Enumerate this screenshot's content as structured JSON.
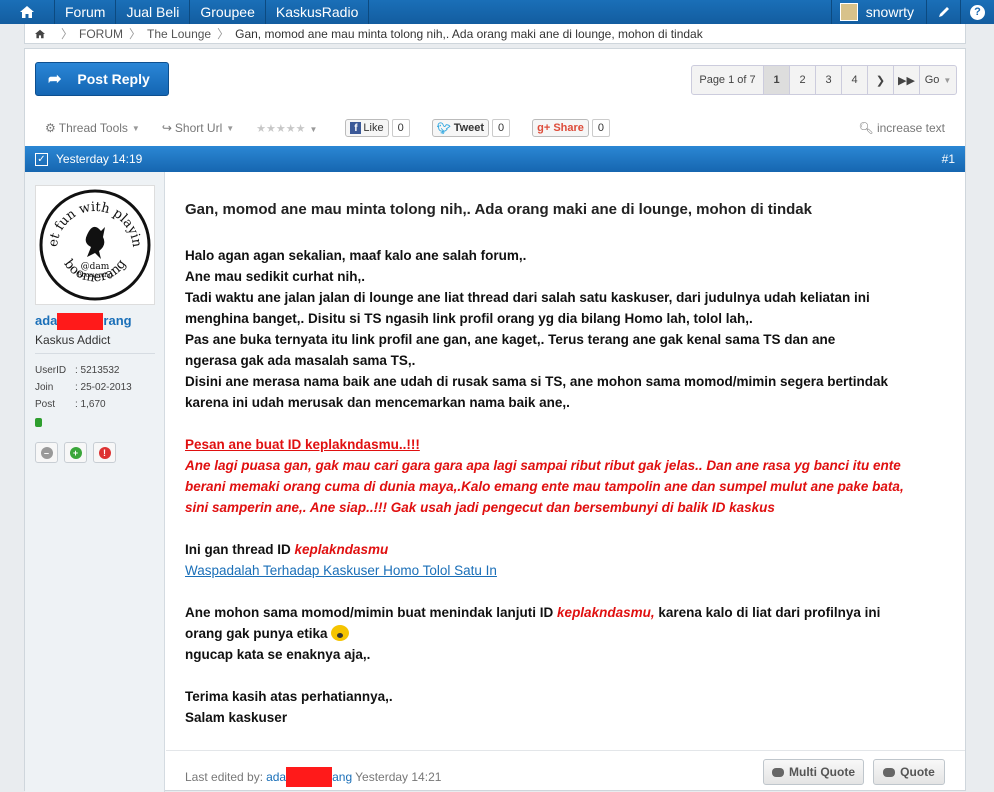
{
  "topnav": {
    "items": [
      "Forum",
      "Jual Beli",
      "Groupee",
      "KaskusRadio"
    ],
    "username": "snowrty"
  },
  "breadcrumb": {
    "forum": "FORUM",
    "section": "The Lounge",
    "current": "Gan, momod ane mau minta tolong nih,. Ada orang maki ane di lounge, mohon di tindak"
  },
  "actions": {
    "post_reply": "Post Reply"
  },
  "pagination": {
    "info": "Page 1 of 7",
    "pages": [
      "1",
      "2",
      "3",
      "4"
    ],
    "current": "1",
    "go": "Go"
  },
  "toolbar": {
    "thread_tools": "Thread Tools",
    "short_url": "Short Url",
    "like_label": "Like",
    "like_count": "0",
    "tweet_label": "Tweet",
    "tweet_count": "0",
    "share_label": "Share",
    "share_count": "0",
    "increase_text": "increase text"
  },
  "post": {
    "time": "Yesterday 14:19",
    "number": "#1",
    "user": {
      "name_start": "ada",
      "name_end": "rang",
      "title": "Kaskus Addict",
      "avatar_text_top": "Let fun with playing",
      "avatar_text_bottom": "boomerang",
      "avatar_brand": "@dam",
      "avatar_brand_sub": "Boomerang",
      "stats": [
        {
          "label": "UserID",
          "value": ": 5213532"
        },
        {
          "label": "Join",
          "value": ": 25-02-2013"
        },
        {
          "label": "Post",
          "value": ": 1,670"
        }
      ]
    },
    "title": "Gan, momod ane mau minta tolong nih,. Ada orang maki ane di lounge, mohon di tindak",
    "para1": [
      "Halo agan agan sekalian, maaf kalo ane salah forum,.",
      "Ane mau sedikit curhat nih,.",
      "Tadi waktu ane jalan jalan di lounge ane liat thread dari salah satu kaskuser, dari judulnya udah keliatan ini",
      "menghina banget,. Disitu si TS ngasih link profil orang yg dia bilang Homo lah, tolol lah,.",
      "Pas ane buka ternyata itu link profil ane gan, ane kaget,. Terus terang ane gak kenal sama TS dan ane",
      "ngerasa gak ada masalah sama TS,.",
      "Disini ane merasa nama baik ane udah di rusak sama si TS, ane mohon sama momod/mimin segera bertindak",
      "karena ini udah merusak dan mencemarkan nama baik ane,."
    ],
    "red_heading": "Pesan ane buat ID keplakndasmu..!!!",
    "red_lines": [
      "Ane lagi puasa gan, gak mau cari gara gara apa lagi sampai ribut ribut gak jelas.. Dan ane rasa yg banci itu ente",
      "berani memaki orang cuma di dunia maya,.Kalo emang ente mau tampolin ane dan sumpel mulut ane pake bata,",
      "sini samperin ane,. Ane siap..!!! Gak usah jadi pengecut dan bersembunyi di balik ID kaskus"
    ],
    "thread_line_prefix": "Ini gan thread ID ",
    "thread_line_id": "keplakndasmu",
    "thread_link": "Waspadalah Terhadap Kaskuser Homo Tolol Satu In",
    "req_prefix": "Ane mohon sama momod/mimin buat menindak lanjuti ID ",
    "req_id": "keplakndasmu,",
    "req_suffix": " karena kalo di liat dari profilnya ini",
    "req_line2": "orang gak punya etika ",
    "req_line3": "ngucap kata se enaknya aja,.",
    "closing1": "Terima kasih atas perhatiannya,.",
    "closing2": "Salam kaskuser",
    "edited_prefix": "Last edited by:",
    "edited_name_start": "ada",
    "edited_name_end": "ang",
    "edited_time": "Yesterday 14:21",
    "multi_quote": "Multi Quote",
    "quote": "Quote"
  },
  "colors": {
    "nav_blue": "#1666b0",
    "accent_red": "#e01010",
    "link_blue": "#1a6fb8"
  }
}
